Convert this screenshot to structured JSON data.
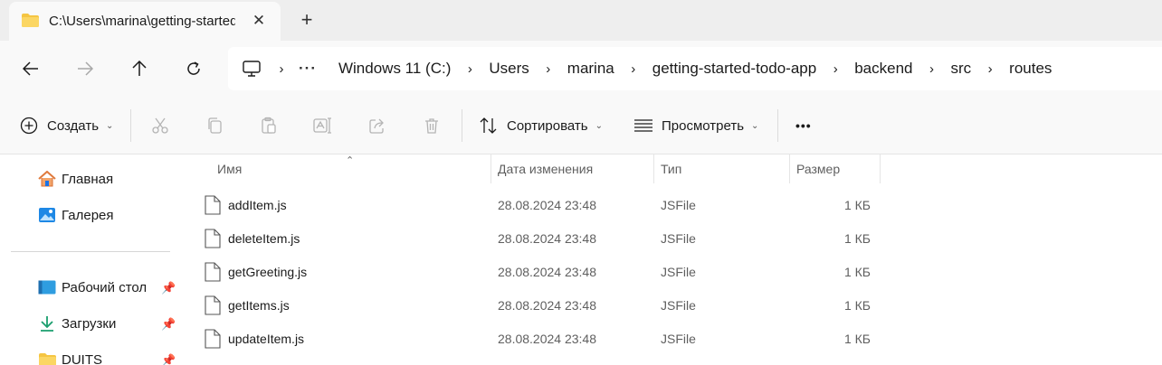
{
  "window": {
    "tab_title": "C:\\Users\\marina\\getting-started",
    "tab_close": "✕",
    "new_tab": "+"
  },
  "address": {
    "more": "···",
    "crumbs": [
      "Windows 11 (C:)",
      "Users",
      "marina",
      "getting-started-todo-app",
      "backend",
      "src",
      "routes"
    ]
  },
  "commands": {
    "create": "Создать",
    "sort": "Сортировать",
    "view": "Просмотреть",
    "more": "•••"
  },
  "sidebar": {
    "items": [
      {
        "label": "Главная",
        "icon": "home-icon"
      },
      {
        "label": "Галерея",
        "icon": "gallery-icon"
      },
      {
        "label": "Рабочий стол",
        "icon": "desktop-icon",
        "pinned": true
      },
      {
        "label": "Загрузки",
        "icon": "downloads-icon",
        "pinned": true
      },
      {
        "label": "DUITS",
        "icon": "folder-icon",
        "pinned": true
      }
    ]
  },
  "table": {
    "columns": [
      "Имя",
      "Дата изменения",
      "Тип",
      "Размер"
    ],
    "rows": [
      {
        "name": "addItem.js",
        "date": "28.08.2024 23:48",
        "type": "JSFile",
        "size": "1 КБ"
      },
      {
        "name": "deleteItem.js",
        "date": "28.08.2024 23:48",
        "type": "JSFile",
        "size": "1 КБ"
      },
      {
        "name": "getGreeting.js",
        "date": "28.08.2024 23:48",
        "type": "JSFile",
        "size": "1 КБ"
      },
      {
        "name": "getItems.js",
        "date": "28.08.2024 23:48",
        "type": "JSFile",
        "size": "1 КБ"
      },
      {
        "name": "updateItem.js",
        "date": "28.08.2024 23:48",
        "type": "JSFile",
        "size": "1 КБ"
      }
    ]
  },
  "colors": {
    "folder": "#f5c542",
    "accent": "#005fb8"
  }
}
